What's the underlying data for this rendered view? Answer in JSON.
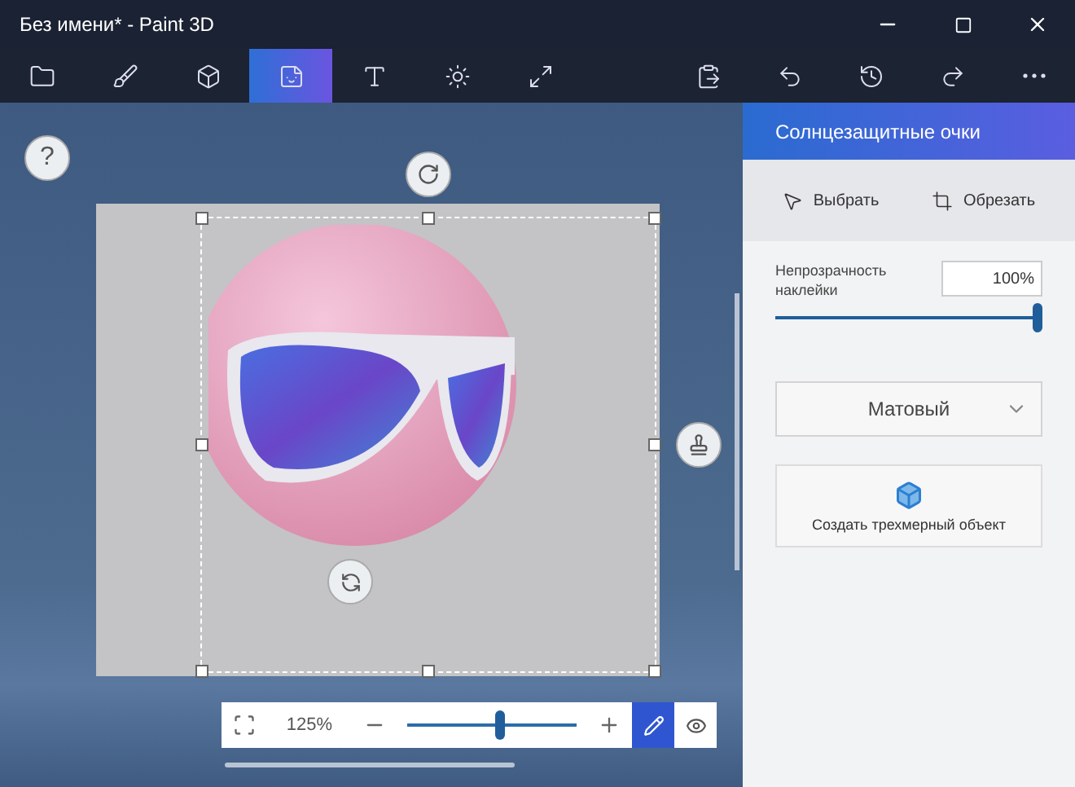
{
  "window": {
    "title": "Без имени* - Paint 3D"
  },
  "tabs": [
    {
      "kind": "folder",
      "selected": false
    },
    {
      "kind": "brush",
      "selected": false
    },
    {
      "kind": "cube",
      "selected": false
    },
    {
      "kind": "sticker",
      "selected": true
    },
    {
      "kind": "text",
      "selected": false
    },
    {
      "kind": "sun",
      "selected": false
    },
    {
      "kind": "resize",
      "selected": false
    }
  ],
  "canvas": {
    "help": "?"
  },
  "zoom_bar": {
    "zoom": "125%",
    "level": 0.55,
    "modes": [
      {
        "kind": "pen",
        "selected": true
      },
      {
        "kind": "eye",
        "selected": false
      }
    ]
  },
  "panel": {
    "title": "Солнцезащитные очки",
    "tools": [
      {
        "kind": "select",
        "label": "Выбрать"
      },
      {
        "kind": "crop",
        "label": "Обрезать"
      }
    ],
    "opacity": {
      "label": "Непрозрачность наклейки",
      "value": "100%",
      "level": 1
    },
    "finish": {
      "value": "Матовый"
    },
    "make_3d": {
      "label": "Создать трехмерный объект"
    }
  }
}
